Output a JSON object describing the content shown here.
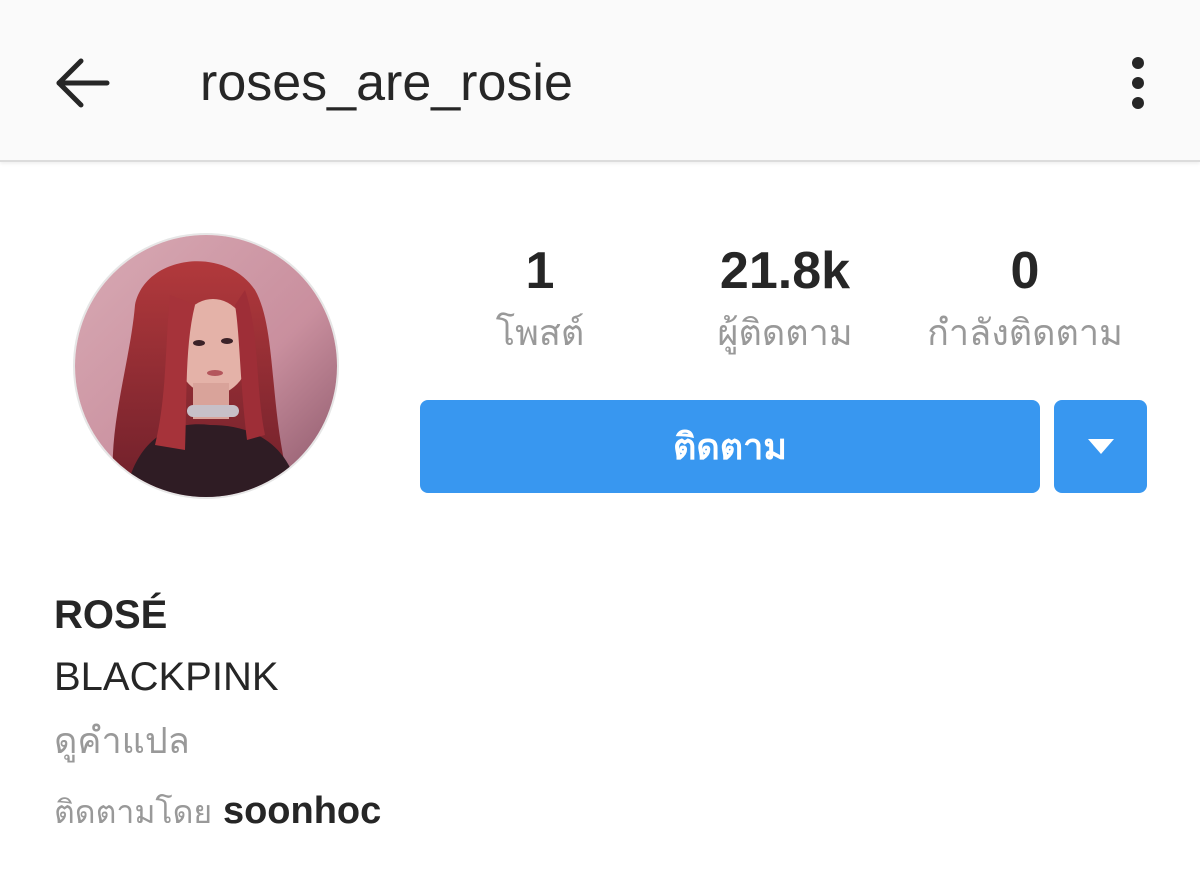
{
  "header": {
    "username": "roses_are_rosie",
    "back_icon": "arrow-left-icon",
    "more_icon": "more-vertical-icon"
  },
  "profile": {
    "avatar_icon": "profile-photo",
    "stats": {
      "posts": {
        "value": "1",
        "label": "โพสต์"
      },
      "followers": {
        "value": "21.8k",
        "label": "ผู้ติดตาม"
      },
      "following": {
        "value": "0",
        "label": "กำลังติดตาม"
      }
    },
    "follow_label": "ติดตาม",
    "dropdown_icon": "caret-down-icon",
    "display_name": "ROSÉ",
    "bio": "BLACKPINK",
    "translate_label": "ดูคำแปล",
    "followed_by_prefix": "ติดตามโดย",
    "followed_by_user": "soonhoc"
  },
  "colors": {
    "accent": "#3897f0",
    "text_primary": "#262626",
    "text_secondary": "#999999",
    "header_bg": "#fafafa"
  }
}
